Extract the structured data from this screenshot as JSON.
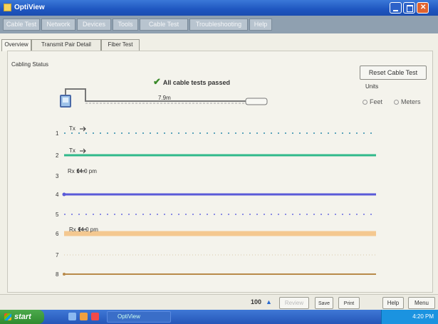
{
  "window": {
    "title": "OptiView"
  },
  "menu": [
    {
      "label": "Cable Test"
    },
    {
      "label": "Network"
    },
    {
      "label": "Devices"
    },
    {
      "label": "Tools"
    },
    {
      "label": "Cable Test"
    },
    {
      "label": "Troubleshooting"
    },
    {
      "label": "Help"
    }
  ],
  "tabs": [
    {
      "label": "Overview",
      "active": true
    },
    {
      "label": "Transmit Pair Detail",
      "active": false
    },
    {
      "label": "Fiber Test",
      "active": false
    }
  ],
  "panel": {
    "section_label": "Cabling Status",
    "status_message": "All cable tests passed",
    "cable_length": "7.9m"
  },
  "controls": {
    "reset_button": "Reset Cable Test",
    "units_label": "Units",
    "units_options": [
      "Feet",
      "Meters"
    ],
    "units_selected": "Feet"
  },
  "pins": [
    {
      "num": "1",
      "style": "dashed",
      "color": "#2a8aaa"
    },
    {
      "num": "2",
      "style": "solid",
      "color": "#2fb98a"
    },
    {
      "num": "3",
      "style": "none",
      "color": "#999999"
    },
    {
      "num": "4",
      "style": "solid",
      "color": "#5a5ad8"
    },
    {
      "num": "5",
      "style": "dashed",
      "color": "#6a6ae0"
    },
    {
      "num": "6",
      "style": "solid",
      "color": "#f4c890"
    },
    {
      "num": "7",
      "style": "dotted",
      "color": "#d8c8a8"
    },
    {
      "num": "8",
      "style": "solid",
      "color": "#b88a4a"
    }
  ],
  "pair_labels": [
    {
      "text": "Tx"
    },
    {
      "text": "Tx"
    },
    {
      "text": "Rx  14.0 pm"
    },
    {
      "text": "Rx  14.0 pm"
    }
  ],
  "bottom_toolbar": {
    "zoom": "100",
    "buttons": [
      "Review",
      "Save",
      "Print",
      "Help",
      "Menu"
    ]
  },
  "taskbar": {
    "start": "start",
    "task_item": "OptiView",
    "clock": "4:20 PM"
  }
}
